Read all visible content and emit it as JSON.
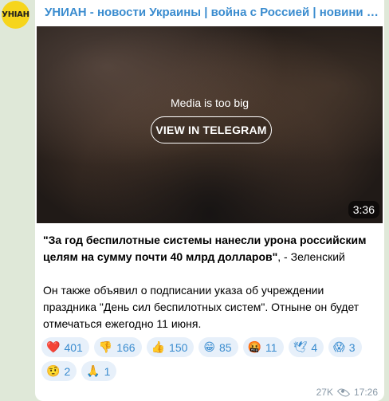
{
  "channel": {
    "avatar_text": "УНІАН",
    "title": "УНИАН - новости Украины | война с Россией | новини Україні..."
  },
  "media": {
    "notice": "Media is too big",
    "button_label": "VIEW IN TELEGRAM",
    "duration": "3:36"
  },
  "post": {
    "quote": "\"За год беспилотные системы нанесли урона российским целям на сумму почти 40 млрд долларов\"",
    "attribution": ", - Зеленский",
    "body": "Он также объявил о подписании указа об учреждении праздника \"День сил беспилотных систем\". Отныне он будет отмечаться ежегодно 11 июня."
  },
  "reactions": [
    {
      "emoji": "❤️",
      "icon": "red-heart-icon",
      "count": "401"
    },
    {
      "emoji": "👎",
      "icon": "thumbs-down-icon",
      "count": "166"
    },
    {
      "emoji": "👍",
      "icon": "thumbs-up-icon",
      "count": "150"
    },
    {
      "emoji": "😁",
      "icon": "grinning-face-icon",
      "count": "85"
    },
    {
      "emoji": "🤬",
      "icon": "cursing-face-icon",
      "count": "11"
    },
    {
      "emoji": "🕊",
      "icon": "dove-icon",
      "count": "4"
    },
    {
      "emoji": "😱",
      "icon": "screaming-face-icon",
      "count": "3"
    },
    {
      "emoji": "🤨",
      "icon": "raised-eyebrow-face-icon",
      "count": "2"
    },
    {
      "emoji": "🙏",
      "icon": "folded-hands-icon",
      "count": "1"
    }
  ],
  "footer": {
    "views": "27K",
    "time": "17:26"
  },
  "colors": {
    "accent": "#3a8ccf",
    "avatar_bg": "#f6d51c",
    "chat_bg": "#dfe8d8"
  }
}
